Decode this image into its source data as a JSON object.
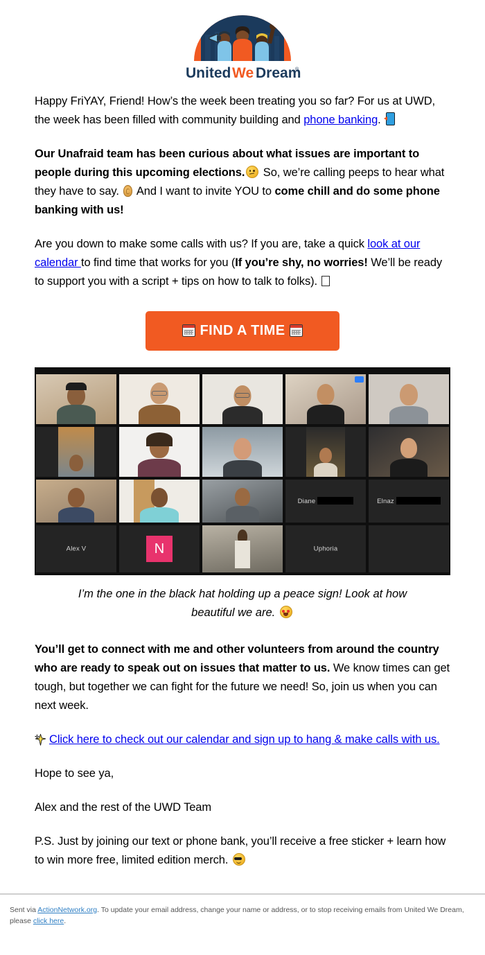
{
  "logo": {
    "wordmark_united": "United",
    "wordmark_we": "We",
    "wordmark_dream": "Dream",
    "registered_mark": "®",
    "alt": "United We Dream",
    "arc_color": "#F15A22",
    "word_navy": "#1B3A5C"
  },
  "body": {
    "p1_part1": "Happy FriYAY, Friend! How’s the week been treating you so far? For us at UWD, the week has been filled with community building and ",
    "p1_link": "phone banking",
    "p1_part2": ". ",
    "p2_bold1": "Our Unafraid team has been curious about what issues are important to people during this upcoming elections.",
    "p2_mid": " So, we’re calling peeps to hear what they have to say. ",
    "p2_mid2": " And I want to invite YOU to ",
    "p2_bold2": "come chill and do some phone banking with us!",
    "p3_part1": "Are you down to make some calls with us? If you are, take a quick ",
    "p3_link": "look at our calendar ",
    "p3_part2": "to find time that works for you (",
    "p3_bold": "If you’re shy, no worries!",
    "p3_part3": " We’ll be ready to support you with a script + tips on how to talk to folks). ",
    "caption": "I’m the one in the black hat holding up a peace sign! Look at how beautiful we are. ",
    "p4_bold": "You’ll get to connect with me and other volunteers from around the country who are ready to speak out on issues that matter to us.",
    "p4_rest": " We know times can get tough, but together we can fight for the future we need! So, join us when you can next week.",
    "p5_link": "Click here to check out our calendar and sign up to hang & make calls with us.",
    "p6": "Hope to see ya,",
    "p7": "Alex and the rest of the UWD Team",
    "p8": "P.S. Just by joining our text or phone bank, you’ll receive a free sticker + learn how to win more free, limited edition merch. "
  },
  "cta": {
    "label": "FIND A TIME",
    "background": "#F15A22",
    "text_color": "#FFFFFF"
  },
  "zoom_call": {
    "rows": [
      [
        {
          "name": "",
          "kind": "video"
        },
        {
          "name": "",
          "kind": "video"
        },
        {
          "name": "",
          "kind": "video"
        },
        {
          "name": "",
          "kind": "video",
          "speaking": true,
          "badge": true
        },
        {
          "name": "",
          "kind": "video"
        }
      ],
      [
        {
          "name": "",
          "kind": "video"
        },
        {
          "name": "",
          "kind": "video"
        },
        {
          "name": "",
          "kind": "video"
        },
        {
          "name": "",
          "kind": "video"
        },
        {
          "name": "",
          "kind": "video"
        }
      ],
      [
        {
          "name": "",
          "kind": "video"
        },
        {
          "name": "",
          "kind": "video"
        },
        {
          "name": "",
          "kind": "video"
        },
        {
          "name": "Diane",
          "kind": "name",
          "redacted": true
        },
        {
          "name": "Elnaz",
          "kind": "name",
          "redacted": true
        }
      ],
      [
        {
          "name": "Alex V",
          "kind": "name"
        },
        {
          "name": "N",
          "kind": "avatar"
        },
        {
          "name": "",
          "kind": "video"
        },
        {
          "name": "Uphoria",
          "kind": "name"
        },
        {
          "name": "",
          "kind": "empty"
        }
      ]
    ],
    "avatar_color": "#E8336D",
    "speaker_border_color": "#3FA34D"
  },
  "footer": {
    "part1": "Sent via ",
    "link1": "ActionNetwork.org",
    "part2": ". To update your email address, change your name or address, or to stop receiving emails from United We Dream, please ",
    "link2": "click here",
    "part3": "."
  }
}
